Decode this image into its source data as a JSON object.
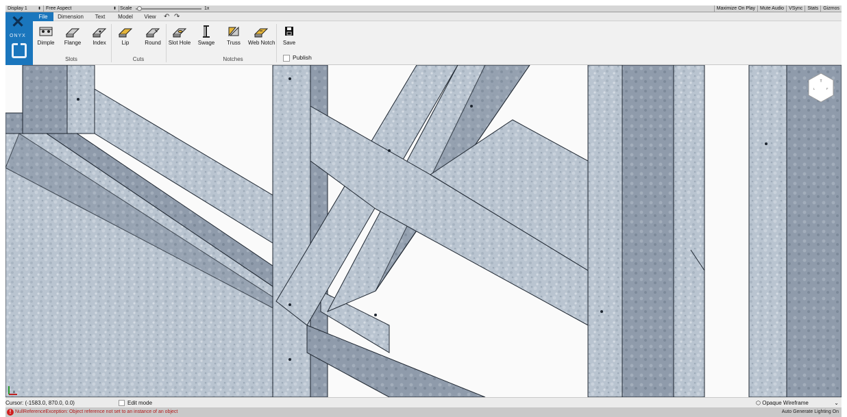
{
  "gamebar": {
    "display": "Display 1",
    "aspect": "Free Aspect",
    "scale_label": "Scale",
    "scale_value": "1x",
    "right_items": [
      "Maximize On Play",
      "Mute Audio",
      "VSync",
      "Stats",
      "Gizmos"
    ]
  },
  "logo": {
    "text": "ONYX"
  },
  "menu": {
    "items": [
      "File",
      "Dimension",
      "Text",
      "Model",
      "View"
    ],
    "active": "File"
  },
  "ribbon": {
    "tools": {
      "dimple": "Dimple",
      "flange": "Flange",
      "index": "Index",
      "lip": "Lip",
      "round": "Round",
      "slot_hole": "Slot Hole",
      "swage": "Swage",
      "truss": "Truss",
      "web_notch": "Web Notch",
      "save": "Save"
    },
    "groups": {
      "slots": "Slots",
      "cuts": "Cuts",
      "notches": "Notches"
    },
    "publish_label": "Publish"
  },
  "viewport": {
    "navcube_icon": "view-cube-icon",
    "axis_icon": "axis-gizmo-icon"
  },
  "status": {
    "cursor": "Cursor: (-1583.0, 870.0, 0.0)",
    "edit_mode": "Edit mode",
    "render_mode": "Opaque Wireframe"
  },
  "console": {
    "error": "NullReferenceException: Object reference not set to an instance of an object",
    "lighting": "Auto Generate Lighting On"
  },
  "colors": {
    "accent": "#1a76bd",
    "steel": "#b8c3cf",
    "steel_dark": "#8c98a6",
    "error": "#d02020"
  }
}
